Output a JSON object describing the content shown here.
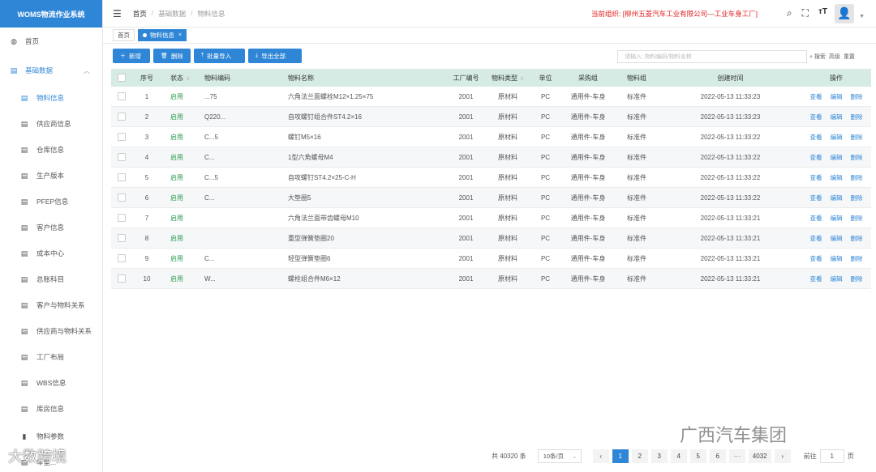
{
  "app": {
    "title": "WOMS物流作业系统"
  },
  "sidebar": {
    "home": "首页",
    "group": "基础数据",
    "items": [
      {
        "label": "物料信息"
      },
      {
        "label": "供应商信息"
      },
      {
        "label": "仓库信息"
      },
      {
        "label": "生产版本"
      },
      {
        "label": "PFEP信息"
      },
      {
        "label": "客户信息"
      },
      {
        "label": "成本中心"
      },
      {
        "label": "总账科目"
      },
      {
        "label": "客户与物料关系"
      },
      {
        "label": "供应商与物料关系"
      },
      {
        "label": "工厂布局"
      },
      {
        "label": "WBS信息"
      },
      {
        "label": "库房信息"
      },
      {
        "label": "物料参数"
      },
      {
        "label": "车型..."
      }
    ]
  },
  "header": {
    "breadcrumb": [
      "首页",
      "基础数据",
      "物料信息"
    ],
    "org": "当前组织: [柳州五菱汽车工业有限公司—工业车身工厂]"
  },
  "tabs": [
    {
      "label": "首页"
    },
    {
      "label": "物料信息"
    }
  ],
  "toolbar": {
    "add": "新增",
    "delete": "删除",
    "import": "批量导入",
    "export": "导出全部"
  },
  "search": {
    "placeholder": "请输入: 物料编码/物料名称",
    "search_btn": "搜索",
    "advanced_btn": "高级",
    "reset_btn": "重置"
  },
  "table": {
    "columns": [
      "序号",
      "状态",
      "物料编码",
      "物料名称",
      "工厂编号",
      "物料类型",
      "单位",
      "采购组",
      "物料组",
      "创建时间",
      "操作"
    ],
    "rows": [
      {
        "seq": "1",
        "status": "启用",
        "code": "...75",
        "name": "六角法兰面螺栓M12×1.25×75",
        "factory": "2001",
        "type": "原材料",
        "unit": "PC",
        "pg": "通用件-车身",
        "mg": "标准件",
        "time": "2022-05-13 11:33:23"
      },
      {
        "seq": "2",
        "status": "启用",
        "code": "Q220...",
        "name": "自攻螺钉组合件ST4.2×16",
        "factory": "2001",
        "type": "原材料",
        "unit": "PC",
        "pg": "通用件-车身",
        "mg": "标准件",
        "time": "2022-05-13 11:33:23"
      },
      {
        "seq": "3",
        "status": "启用",
        "code": "C...5",
        "name": "螺钉M5×16",
        "factory": "2001",
        "type": "原材料",
        "unit": "PC",
        "pg": "通用件-车身",
        "mg": "标准件",
        "time": "2022-05-13 11:33:22"
      },
      {
        "seq": "4",
        "status": "启用",
        "code": "C...",
        "name": "1型六角螺母M4",
        "factory": "2001",
        "type": "原材料",
        "unit": "PC",
        "pg": "通用件-车身",
        "mg": "标准件",
        "time": "2022-05-13 11:33:22"
      },
      {
        "seq": "5",
        "status": "启用",
        "code": "C...5",
        "name": "自攻螺钉ST4.2×25-C-H",
        "factory": "2001",
        "type": "原材料",
        "unit": "PC",
        "pg": "通用件-车身",
        "mg": "标准件",
        "time": "2022-05-13 11:33:22"
      },
      {
        "seq": "6",
        "status": "启用",
        "code": "C...",
        "name": "大垫圈5",
        "factory": "2001",
        "type": "原材料",
        "unit": "PC",
        "pg": "通用件-车身",
        "mg": "标准件",
        "time": "2022-05-13 11:33:22"
      },
      {
        "seq": "7",
        "status": "启用",
        "code": "",
        "name": "六角法兰面带齿螺母M10",
        "factory": "2001",
        "type": "原材料",
        "unit": "PC",
        "pg": "通用件-车身",
        "mg": "标准件",
        "time": "2022-05-13 11:33:21"
      },
      {
        "seq": "8",
        "status": "启用",
        "code": "",
        "name": "重型弹簧垫圈20",
        "factory": "2001",
        "type": "原材料",
        "unit": "PC",
        "pg": "通用件-车身",
        "mg": "标准件",
        "time": "2022-05-13 11:33:21"
      },
      {
        "seq": "9",
        "status": "启用",
        "code": "C...",
        "name": "轻型弹簧垫圈6",
        "factory": "2001",
        "type": "原材料",
        "unit": "PC",
        "pg": "通用件-车身",
        "mg": "标准件",
        "time": "2022-05-13 11:33:21"
      },
      {
        "seq": "10",
        "status": "启用",
        "code": "W...",
        "name": "螺栓组合件M6×12",
        "factory": "2001",
        "type": "原材料",
        "unit": "PC",
        "pg": "通用件-车身",
        "mg": "标准件",
        "time": "2022-05-13 11:33:21"
      }
    ],
    "ops": {
      "view": "查看",
      "edit": "编辑",
      "del": "删除"
    }
  },
  "pagination": {
    "total": "共 40320 条",
    "page_size": "10条/页",
    "pages": [
      "1",
      "2",
      "3",
      "4",
      "5",
      "6",
      "···",
      "4032"
    ],
    "goto_label": "前往",
    "goto_value": "1",
    "page_suffix": "页"
  },
  "watermark": {
    "right": "广西汽车集团",
    "left": "大数跨境"
  },
  "colors": {
    "primary": "#2f86d6",
    "header_row": "#d5ebe4",
    "status_green": "#2e9d52",
    "org_red": "#e02020"
  }
}
